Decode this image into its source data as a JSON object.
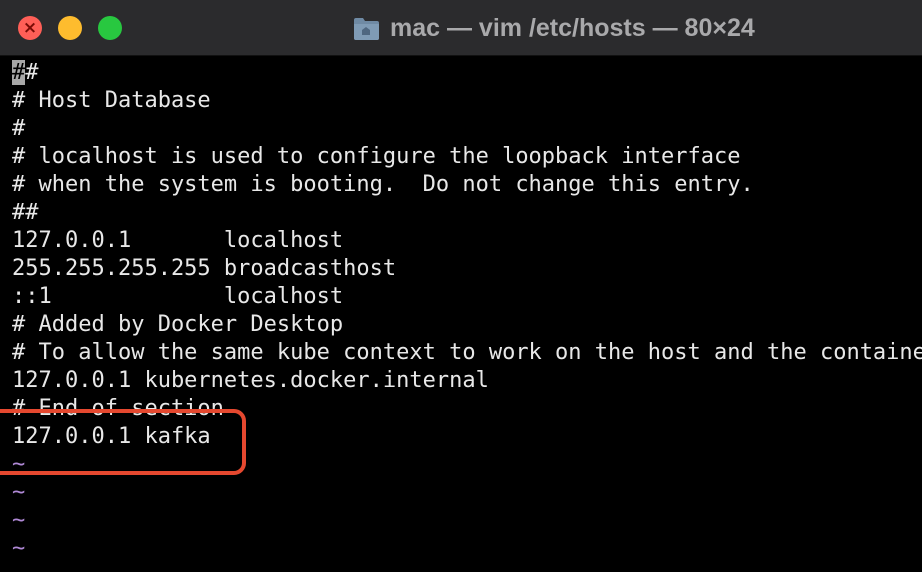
{
  "window": {
    "title": "mac — vim /etc/hosts — 80×24",
    "controls": {
      "close_glyph": "×"
    }
  },
  "terminal": {
    "cursor_char": "#",
    "lines": [
      "##",
      "# Host Database",
      "#",
      "# localhost is used to configure the loopback interface",
      "# when the system is booting.  Do not change this entry.",
      "##",
      "127.0.0.1       localhost",
      "255.255.255.255 broadcasthost",
      "::1             localhost",
      "# Added by Docker Desktop",
      "# To allow the same kube context to work on the host and the container:",
      "127.0.0.1 kubernetes.docker.internal",
      "# End of section",
      "127.0.0.1 kafka"
    ],
    "line_0_rest": "#",
    "tilde_lines": [
      "~",
      "~",
      "~",
      "~"
    ]
  },
  "colors": {
    "close": "#ff5f57",
    "minimize": "#febc2e",
    "zoom": "#28c840",
    "annotation": "#e5482f",
    "tilde": "#b089d6"
  }
}
